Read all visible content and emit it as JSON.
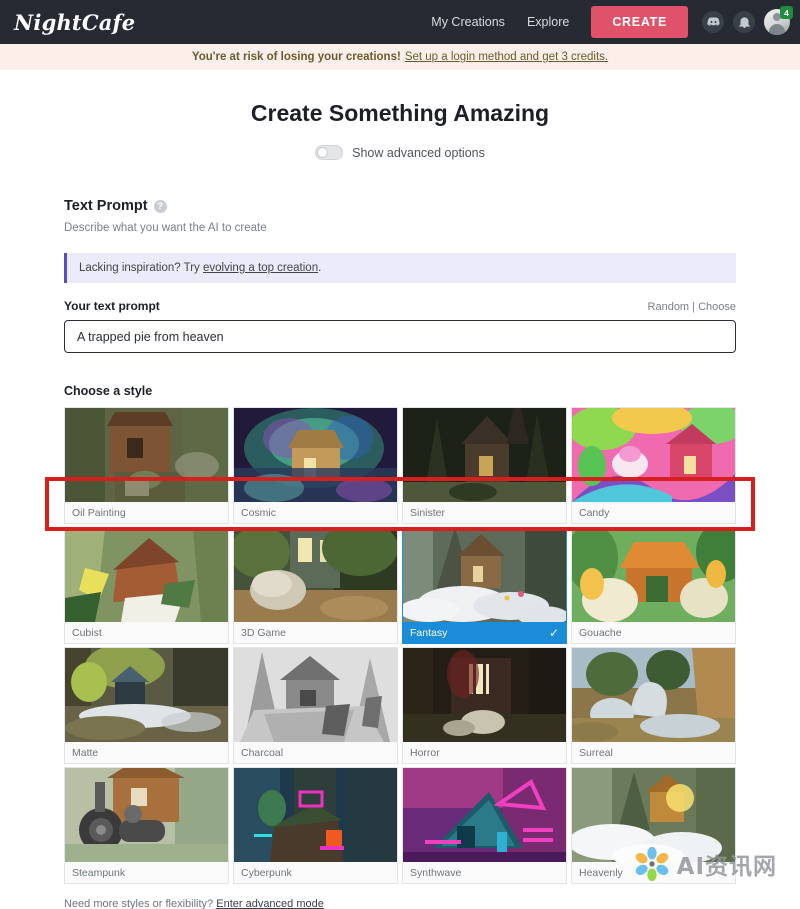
{
  "navbar": {
    "logo": "NightCafe",
    "links": [
      {
        "label": "My Creations"
      },
      {
        "label": "Explore"
      }
    ],
    "create_label": "CREATE",
    "discord_icon": "discord-icon",
    "bell_icon": "bell-icon",
    "avatar_badge": "4",
    "bg_color": "#262b33",
    "create_color": "#e0516a"
  },
  "banner": {
    "strong": "You're at risk of losing your creations!",
    "link": "Set up a login method and get 3 credits.",
    "bg_color": "#fcefe9"
  },
  "page": {
    "title": "Create Something Amazing",
    "advanced_toggle_label": "Show advanced options",
    "advanced_toggle_on": false
  },
  "text_prompt": {
    "section_title": "Text Prompt",
    "help_icon": "question-mark-icon",
    "subtitle": "Describe what you want the AI to create",
    "inspiration_prefix": "Lacking inspiration? Try ",
    "inspiration_link": "evolving a top creation",
    "inspiration_suffix": ".",
    "inspiration_bg": "#ecebfa",
    "prompt_label": "Your text prompt",
    "random_label": "Random",
    "divider_label": " | ",
    "choose_label": "Choose",
    "prompt_value": "A trapped pie from heaven",
    "prompt_placeholder": "A trapped pie from heaven"
  },
  "styles": {
    "label": "Choose a style",
    "selected_color": "#1a8cd8",
    "check_glyph": "✓",
    "items": [
      {
        "label": "Oil Painting",
        "selected": false
      },
      {
        "label": "Cosmic",
        "selected": false
      },
      {
        "label": "Sinister",
        "selected": false
      },
      {
        "label": "Candy",
        "selected": false
      },
      {
        "label": "Cubist",
        "selected": false
      },
      {
        "label": "3D Game",
        "selected": false
      },
      {
        "label": "Fantasy",
        "selected": true
      },
      {
        "label": "Gouache",
        "selected": false
      },
      {
        "label": "Matte",
        "selected": false
      },
      {
        "label": "Charcoal",
        "selected": false
      },
      {
        "label": "Horror",
        "selected": false
      },
      {
        "label": "Surreal",
        "selected": false
      },
      {
        "label": "Steampunk",
        "selected": false
      },
      {
        "label": "Cyberpunk",
        "selected": false
      },
      {
        "label": "Synthwave",
        "selected": false
      },
      {
        "label": "Heavenly",
        "selected": false
      }
    ]
  },
  "footer": {
    "note_prefix": "Need more styles or flexibility? ",
    "note_link": "Enter advanced mode"
  },
  "watermark": {
    "text": "AI资讯网"
  },
  "annotation": {
    "color": "#d81f1f"
  }
}
